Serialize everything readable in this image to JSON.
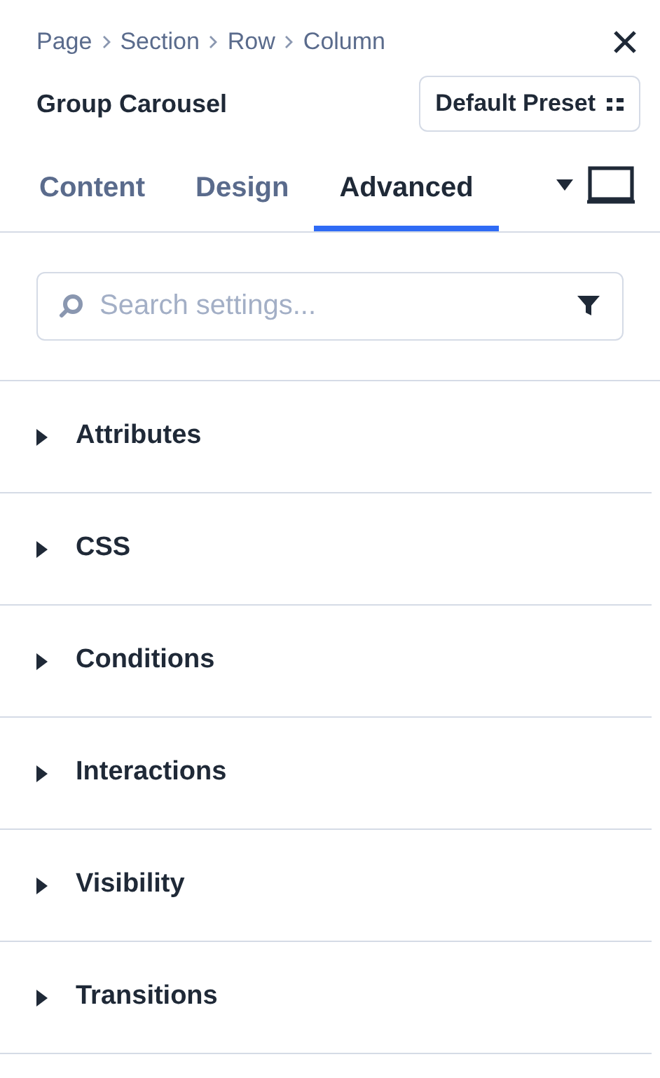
{
  "breadcrumb": [
    "Page",
    "Section",
    "Row",
    "Column"
  ],
  "title": "Group Carousel",
  "preset": {
    "label": "Default Preset"
  },
  "tabs": [
    {
      "label": "Content",
      "selected": false
    },
    {
      "label": "Design",
      "selected": false
    },
    {
      "label": "Advanced",
      "selected": true
    }
  ],
  "search": {
    "placeholder": "Search settings..."
  },
  "sections": [
    {
      "label": "Attributes",
      "expanded": false
    },
    {
      "label": "CSS",
      "expanded": false
    },
    {
      "label": "Conditions",
      "expanded": false
    },
    {
      "label": "Interactions",
      "expanded": false
    },
    {
      "label": "Visibility",
      "expanded": false
    },
    {
      "label": "Transitions",
      "expanded": false
    }
  ]
}
